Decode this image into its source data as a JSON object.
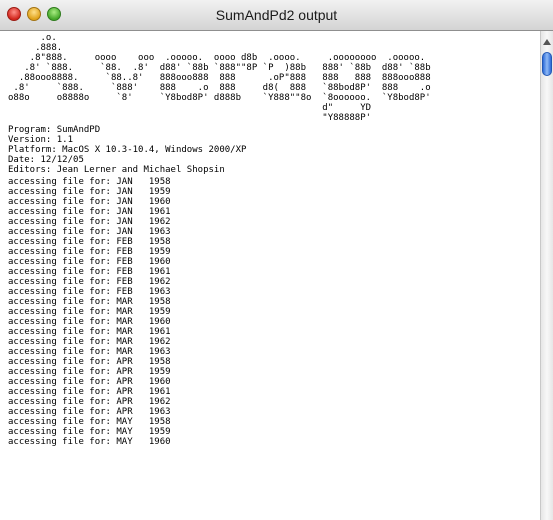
{
  "window": {
    "title": "SumAndPd2 output"
  },
  "output": {
    "banner": [
      "      .o.",
      "     .888.",
      "    .8\"888.     oooo    ooo  .ooooo.  oooo d8b  .oooo.     .oooooooo  .ooooo.",
      "   .8' `888.     `88.  .8'  d88' `88b `888\"\"8P `P  )88b   888' `88b  d88' `88b",
      "  .88ooo8888.     `88..8'   888ooo888  888      .oP\"888   888   888  888ooo888",
      " .8'     `888.     `888'    888    .o  888     d8(  888   `88bod8P'  888    .o",
      "o88o     o8888o     `8'     `Y8bod8P' d888b    `Y888\"\"8o  `8oooooo.  `Y8bod8P'",
      "                                                          d\"     YD",
      "                                                          \"Y88888P'"
    ],
    "header": [
      "Program: SumAndPD",
      "Version: 1.1",
      "Platform: MacOS X 10.3-10.4, Windows 2000/XP",
      "Date: 12/12/05",
      "Editors: Jean Lerner and Michael Shopsin"
    ],
    "log": [
      "accessing file for: JAN   1958",
      "accessing file for: JAN   1959",
      "accessing file for: JAN   1960",
      "accessing file for: JAN   1961",
      "accessing file for: JAN   1962",
      "accessing file for: JAN   1963",
      "accessing file for: FEB   1958",
      "accessing file for: FEB   1959",
      "accessing file for: FEB   1960",
      "accessing file for: FEB   1961",
      "accessing file for: FEB   1962",
      "accessing file for: FEB   1963",
      "accessing file for: MAR   1958",
      "accessing file for: MAR   1959",
      "accessing file for: MAR   1960",
      "accessing file for: MAR   1961",
      "accessing file for: MAR   1962",
      "accessing file for: MAR   1963",
      "accessing file for: APR   1958",
      "accessing file for: APR   1959",
      "accessing file for: APR   1960",
      "accessing file for: APR   1961",
      "accessing file for: APR   1962",
      "accessing file for: APR   1963",
      "accessing file for: MAY   1958",
      "accessing file for: MAY   1959",
      "accessing file for: MAY   1960"
    ]
  }
}
